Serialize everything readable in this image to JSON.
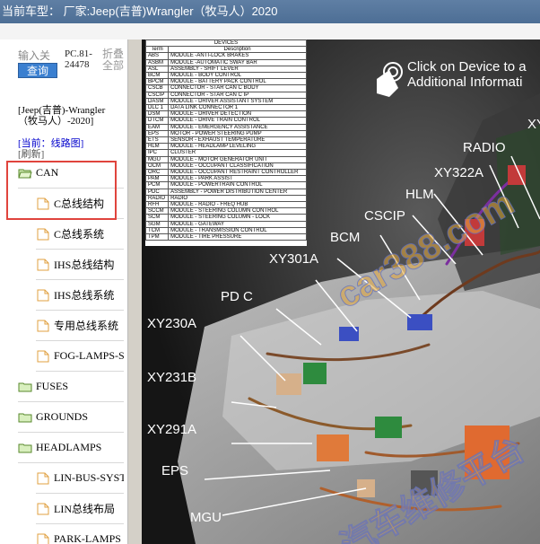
{
  "title_bar": {
    "text": "当前车型：  厂家:Jeep(吉普)Wrangler（牧马人）2020"
  },
  "left_panel": {
    "search_placeholder": "输入关",
    "search_button": "查询",
    "pc_code": "PC.81-24478",
    "collapse_all": "折叠全部",
    "vehicle_info": "[Jeep(吉普)-Wrangler（牧马人）-2020]",
    "current_link": "[当前：线路图]",
    "refresh_link": "[刷新]",
    "tree": [
      {
        "label": "CAN",
        "type": "folder-open",
        "level": 0
      },
      {
        "label": "C总线结构",
        "type": "page",
        "level": 1
      },
      {
        "label": "C总线系统",
        "type": "page",
        "level": 1
      },
      {
        "label": "IHS总线结构",
        "type": "page",
        "level": 1
      },
      {
        "label": "IHS总线系统",
        "type": "page",
        "level": 1
      },
      {
        "label": "专用总线系统",
        "type": "page",
        "level": 1
      },
      {
        "label": "FOG-LAMPS-S",
        "type": "page",
        "level": 1
      },
      {
        "label": "FUSES",
        "type": "folder",
        "level": 0
      },
      {
        "label": "GROUNDS",
        "type": "folder",
        "level": 0
      },
      {
        "label": "HEADLAMPS",
        "type": "folder",
        "level": 0
      },
      {
        "label": "LIN-BUS-SYST",
        "type": "page",
        "level": 1
      },
      {
        "label": "LIN总线布局",
        "type": "page",
        "level": 1
      },
      {
        "label": "PARK-LAMPS",
        "type": "page",
        "level": 1
      }
    ],
    "colors": {
      "highlight_border": "#e0443d",
      "search_button_bg": "#3a7fd0",
      "link": "#0000cc"
    }
  },
  "diagram": {
    "click_note": [
      "Click on Device to a",
      "Additional Informati"
    ],
    "legend": {
      "title": "DEVICES",
      "headers": [
        "Term",
        "Description"
      ],
      "rows": [
        [
          "ABS",
          "MODULE -ANTI-LOCK BRAKES"
        ],
        [
          "ASBM",
          "MODULE -AUTOMATIC SWAY BAR"
        ],
        [
          "ASL",
          "ASSEMBLY - SHIFT LEVER"
        ],
        [
          "BCM",
          "MODULE - BODY CONTROL"
        ],
        [
          "BPCM",
          "MODULE - BATTERY PACK CONTROL"
        ],
        [
          "CSCB",
          "CONNECTOR - STAR CAN C BODY"
        ],
        [
          "CSCIP",
          "CONNECTOR - STAR CAN C IP"
        ],
        [
          "DASM",
          "MODULE - DRIVER ASSISTANT SYSTEM"
        ],
        [
          "DLC 1",
          "DATA LINK CONNECTOR 1"
        ],
        [
          "DSM",
          "MODULE - DRIVER DETECTION"
        ],
        [
          "DTCM",
          "MODULE - DRIVE TRAIN CONTROL"
        ],
        [
          "EAM",
          "MODULE - EMERGENCY ASSISTANCE"
        ],
        [
          "EPS",
          "MOTOR - POWER STEERING PUMP"
        ],
        [
          "ETS",
          "SENSOR - EXHAUST TEMPERATURE"
        ],
        [
          "HLM",
          "MODULE - HEADLAMP LEVELING"
        ],
        [
          "IPC",
          "CLUSTER"
        ],
        [
          "MGU",
          "MODULE - MOTOR GENERATOR UNIT"
        ],
        [
          "OCM",
          "MODULE - OCCUPANT CLASSIFICATION"
        ],
        [
          "ORC",
          "MODULE - OCCUPANT RESTRAINT CONTROLLER"
        ],
        [
          "PAM",
          "MODULE - PARK ASSIST"
        ],
        [
          "PCM",
          "MODULE - POWERTRAIN CONTROL"
        ],
        [
          "PDC",
          "ASSEMBLY - POWER DISTRIBUTION CENTER"
        ],
        [
          "RADIO",
          "RADIO"
        ],
        [
          "RFH",
          "MODULE - RADIO - FREQ HUB"
        ],
        [
          "SCCM",
          "MODULE - STEERING COLUMN CONTROL"
        ],
        [
          "SCM",
          "MODULE - STEERING COLUMN - LOCK"
        ],
        [
          "SGM",
          "MODULE - GATEWAY"
        ],
        [
          "TCM",
          "MODULE - TRANSMISSION CONTROL"
        ],
        [
          "TPM",
          "MODULE - TIRE PRESSURE"
        ]
      ]
    },
    "callouts": {
      "radio": "RADIO",
      "xy322a": "XY322A",
      "hlm": "HLM",
      "cscip": "CSCIP",
      "bcm": "BCM",
      "xy301a": "XY301A",
      "pdc": "PD C",
      "xy230a": "XY230A",
      "xy231b": "XY231B",
      "xy291a": "XY291A",
      "eps": "EPS",
      "mgu": "MGU",
      "xy_edge": "XY"
    },
    "watermark": "car388.com",
    "watermark2": "汽车维修平台"
  }
}
